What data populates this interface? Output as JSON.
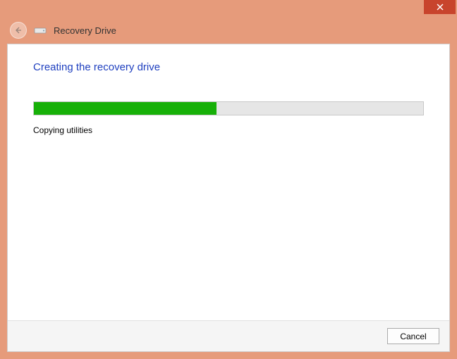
{
  "window": {
    "title": "Recovery Drive"
  },
  "page": {
    "heading": "Creating the recovery drive",
    "status": "Copying utilities",
    "progress_percent": 47
  },
  "footer": {
    "cancel_label": "Cancel"
  },
  "colors": {
    "chrome": "#e69b7b",
    "close": "#c8442c",
    "heading": "#1e3fbf",
    "progress_fill": "#17b008",
    "progress_track": "#e6e6e6"
  }
}
